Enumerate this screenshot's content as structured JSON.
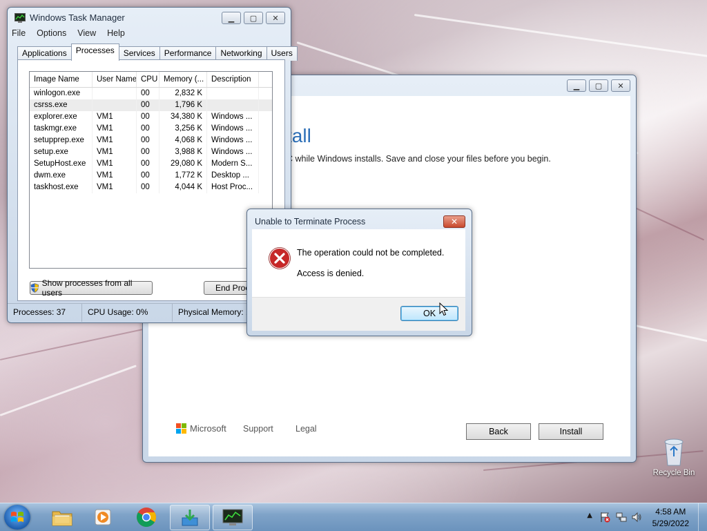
{
  "desktop": {
    "recycle_bin_label": "Recycle Bin"
  },
  "task_manager": {
    "title": "Windows Task Manager",
    "menu": [
      "File",
      "Options",
      "View",
      "Help"
    ],
    "tabs": [
      "Applications",
      "Processes",
      "Services",
      "Performance",
      "Networking",
      "Users"
    ],
    "active_tab": "Processes",
    "columns": [
      "Image Name",
      "User Name",
      "CPU",
      "Memory (...",
      "Description"
    ],
    "processes": [
      {
        "name": "winlogon.exe",
        "user": "",
        "cpu": "00",
        "memory": "2,832 K",
        "description": ""
      },
      {
        "name": "csrss.exe",
        "user": "",
        "cpu": "00",
        "memory": "1,796 K",
        "description": ""
      },
      {
        "name": "explorer.exe",
        "user": "VM1",
        "cpu": "00",
        "memory": "34,380 K",
        "description": "Windows ..."
      },
      {
        "name": "taskmgr.exe",
        "user": "VM1",
        "cpu": "00",
        "memory": "3,256 K",
        "description": "Windows ..."
      },
      {
        "name": "setupprep.exe",
        "user": "VM1",
        "cpu": "00",
        "memory": "4,068 K",
        "description": "Windows ..."
      },
      {
        "name": "setup.exe",
        "user": "VM1",
        "cpu": "00",
        "memory": "3,988 K",
        "description": "Windows ..."
      },
      {
        "name": "SetupHost.exe",
        "user": "VM1",
        "cpu": "00",
        "memory": "29,080 K",
        "description": "Modern S..."
      },
      {
        "name": "dwm.exe",
        "user": "VM1",
        "cpu": "00",
        "memory": "1,772 K",
        "description": "Desktop ..."
      },
      {
        "name": "taskhost.exe",
        "user": "VM1",
        "cpu": "00",
        "memory": "4,044 K",
        "description": "Host Proc..."
      }
    ],
    "show_all_label": "Show processes from all users",
    "end_process_label": "End Proce",
    "status": {
      "processes": "Processes: 37",
      "cpu": "CPU Usage: 0%",
      "memory": "Physical Memory: 1"
    }
  },
  "setup_window": {
    "heading_partial": "tall",
    "text_partial": "C while Windows installs. Save and close your files before you begin.",
    "brand": "Microsoft",
    "links": [
      "Support",
      "Legal"
    ],
    "back_label": "Back",
    "install_label": "Install"
  },
  "error_dialog": {
    "title": "Unable to Terminate Process",
    "message": "The operation could not be completed.",
    "detail": "Access is denied.",
    "ok_label": "OK"
  },
  "taskbar": {
    "time": "4:58 AM",
    "date": "5/29/2022"
  }
}
